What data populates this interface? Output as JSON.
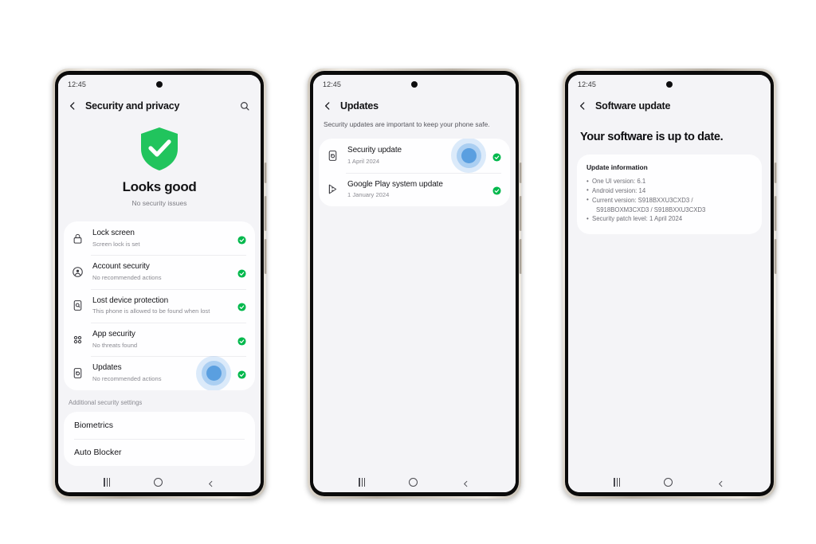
{
  "phones": [
    {
      "status": {
        "time": "12:45"
      },
      "header": {
        "title": "Security and privacy",
        "back_icon": "chevron-left-icon",
        "search_icon": "search-icon"
      },
      "hero": {
        "icon": "shield-check-icon",
        "title": "Looks good",
        "subtitle": "No security issues"
      },
      "rows": [
        {
          "icon": "padlock-icon",
          "title": "Lock screen",
          "subtitle": "Screen lock is set",
          "status": "ok"
        },
        {
          "icon": "account-person-icon",
          "title": "Account security",
          "subtitle": "No recommended actions",
          "status": "ok"
        },
        {
          "icon": "phone-search-icon",
          "title": "Lost device protection",
          "subtitle": "This phone is allowed to be found when lost",
          "status": "ok"
        },
        {
          "icon": "app-grid-icon",
          "title": "App security",
          "subtitle": "No threats found",
          "status": "ok"
        },
        {
          "icon": "phone-refresh-icon",
          "title": "Updates",
          "subtitle": "No recommended actions",
          "status": "ok",
          "tap": true
        }
      ],
      "section_label": "Additional security settings",
      "extra_rows": [
        {
          "title": "Biometrics"
        },
        {
          "title": "Auto Blocker"
        }
      ],
      "nav": {
        "recents": "recents-icon",
        "home": "home-icon",
        "back": "back-icon"
      }
    },
    {
      "status": {
        "time": "12:45"
      },
      "header": {
        "title": "Updates",
        "back_icon": "chevron-left-icon"
      },
      "description": "Security updates are important to keep your phone safe.",
      "rows": [
        {
          "icon": "phone-refresh-icon",
          "title": "Security update",
          "subtitle": "1 April 2024",
          "status": "ok",
          "tap": true
        },
        {
          "icon": "google-play-icon",
          "title": "Google Play system update",
          "subtitle": "1 January 2024",
          "status": "ok"
        }
      ],
      "nav": {
        "recents": "recents-icon",
        "home": "home-icon",
        "back": "back-icon"
      }
    },
    {
      "status": {
        "time": "12:45"
      },
      "header": {
        "title": "Software update",
        "back_icon": "chevron-left-icon"
      },
      "headline": "Your software is up to date.",
      "info": {
        "title": "Update information",
        "items": [
          "One UI version: 6.1",
          "Android version: 14",
          "Current version: S918BXXU3CXD3 /",
          "S918BOXM3CXD3 / S918BXXU3CXD3",
          "Security patch level: 1 April 2024"
        ]
      },
      "nav": {
        "recents": "recents-icon",
        "home": "home-icon",
        "back": "back-icon"
      }
    }
  ],
  "colors": {
    "accent_green": "#00b84c",
    "tap_blue": "#5a9fe0",
    "screen_bg": "#f4f4f7",
    "card_bg": "#fefeff",
    "frame": "#cfc8bd"
  }
}
